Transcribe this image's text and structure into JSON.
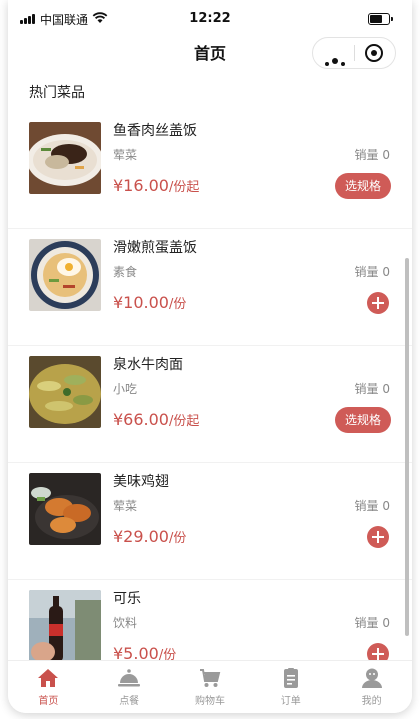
{
  "status_bar": {
    "carrier": "中国联通",
    "time": "12:22"
  },
  "nav": {
    "title": "首页"
  },
  "section": {
    "title": "热门菜品"
  },
  "dishes": [
    {
      "name": "鱼香肉丝盖饭",
      "category": "荤菜",
      "sales": "销量 0",
      "price": "¥16.00",
      "unit": "/份起",
      "action": "选规格"
    },
    {
      "name": "滑嫩煎蛋盖饭",
      "category": "素食",
      "sales": "销量 0",
      "price": "¥10.00",
      "unit": "/份",
      "action": "add"
    },
    {
      "name": "泉水牛肉面",
      "category": "小吃",
      "sales": "销量 0",
      "price": "¥66.00",
      "unit": "/份起",
      "action": "选规格"
    },
    {
      "name": "美味鸡翅",
      "category": "荤菜",
      "sales": "销量 0",
      "price": "¥29.00",
      "unit": "/份",
      "action": "add"
    },
    {
      "name": "可乐",
      "category": "饮料",
      "sales": "销量 0",
      "price": "¥5.00",
      "unit": "/份",
      "action": "add"
    }
  ],
  "tabbar": {
    "tabs": [
      {
        "label": "首页",
        "icon": "home-icon",
        "active": true
      },
      {
        "label": "点餐",
        "icon": "dish-cover-icon",
        "active": false
      },
      {
        "label": "购物车",
        "icon": "cart-icon",
        "active": false
      },
      {
        "label": "订单",
        "icon": "order-icon",
        "active": false
      },
      {
        "label": "我的",
        "icon": "user-icon",
        "active": false
      }
    ]
  },
  "colors": {
    "accent": "#cf5b57",
    "tab_active": "#c9514c",
    "tab_inactive": "#9a9a9a"
  }
}
